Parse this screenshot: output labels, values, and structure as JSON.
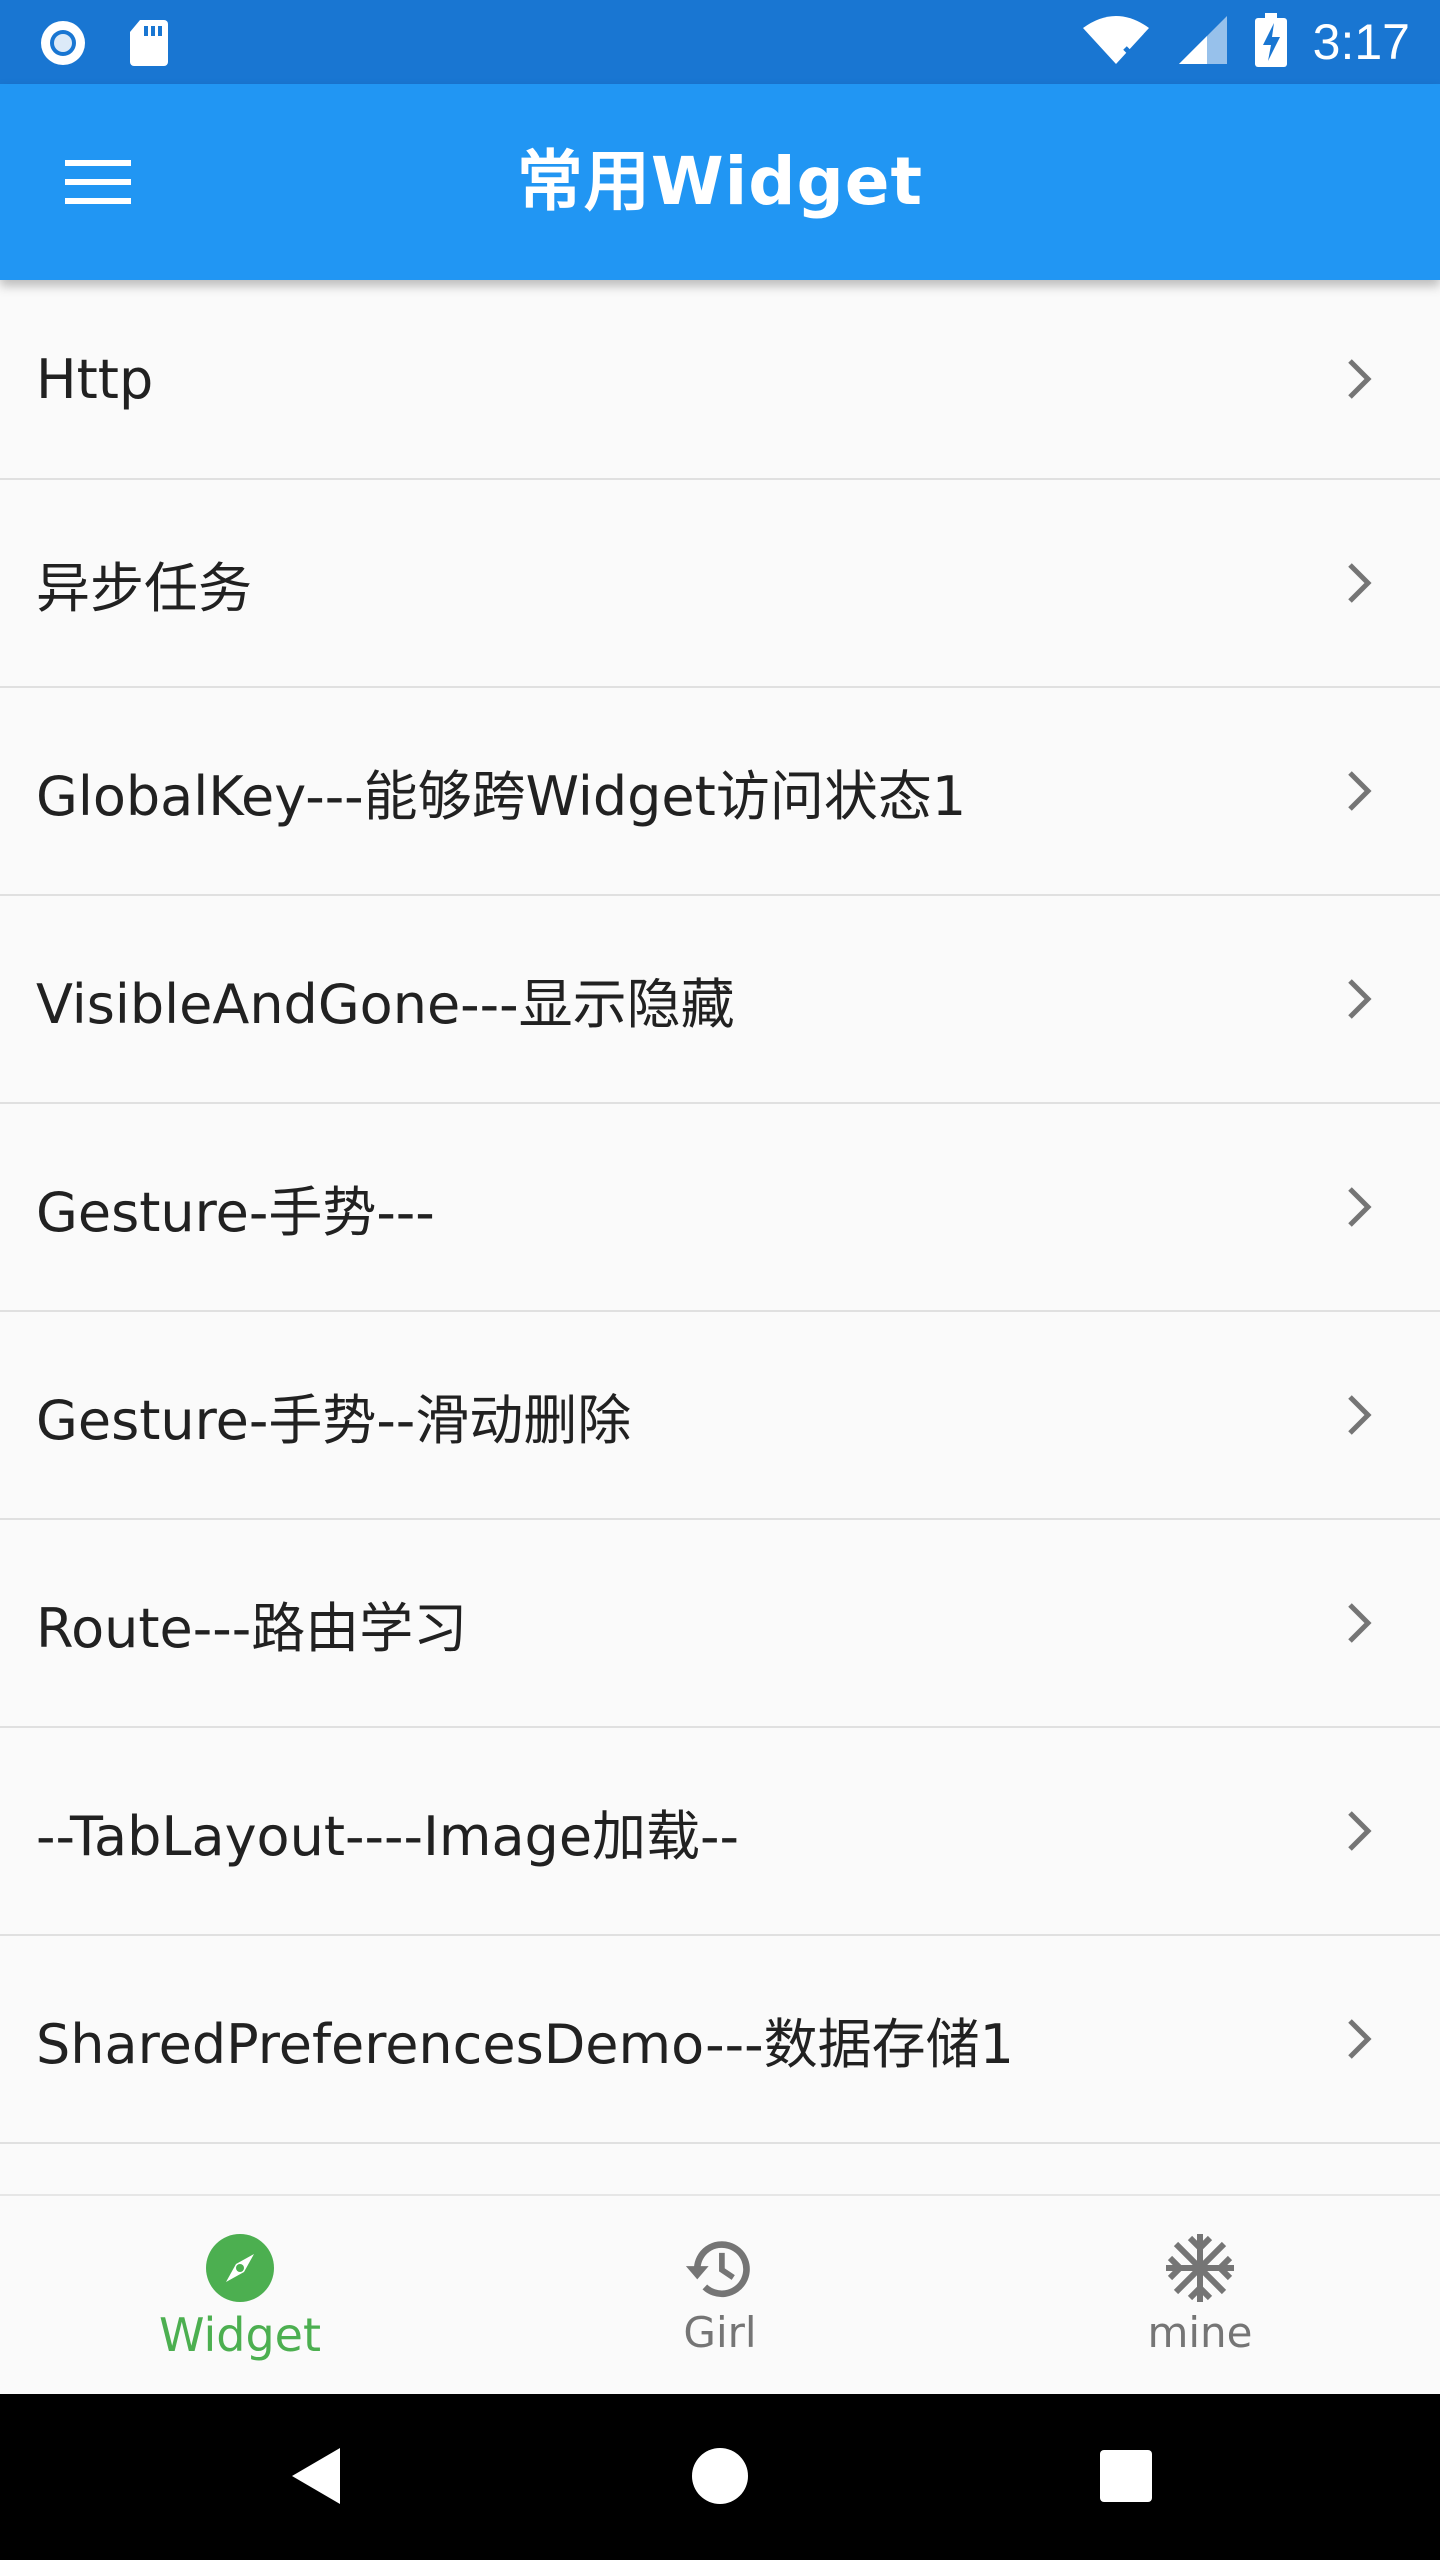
{
  "status_bar": {
    "time": "3:17",
    "icons": [
      "record-icon",
      "sd-card-icon",
      "wifi-icon",
      "signal-icon",
      "battery-charging-icon"
    ]
  },
  "app_bar": {
    "title": "常用Widget",
    "menu_icon": "menu-icon"
  },
  "list": {
    "items": [
      {
        "label": "Http"
      },
      {
        "label": "异步任务"
      },
      {
        "label": "GlobalKey---能够跨Widget访问状态1"
      },
      {
        "label": "VisibleAndGone---显示隐藏"
      },
      {
        "label": "Gesture-手势---"
      },
      {
        "label": "Gesture-手势--滑动删除"
      },
      {
        "label": "Route---路由学习"
      },
      {
        "label": "--TabLayout----Image加载--"
      },
      {
        "label": "SharedPreferencesDemo---数据存储1"
      }
    ],
    "chevron_icon": "chevron-right-icon"
  },
  "bottom_nav": {
    "items": [
      {
        "label": "Widget",
        "icon": "compass-icon",
        "active": true
      },
      {
        "label": "Girl",
        "icon": "history-icon",
        "active": false
      },
      {
        "label": "mine",
        "icon": "snowflake-icon",
        "active": false
      }
    ],
    "active_color": "#4caf50",
    "inactive_color": "#757575"
  },
  "system_nav": {
    "buttons": [
      "back-icon",
      "home-icon",
      "recents-icon"
    ]
  },
  "colors": {
    "status_bar": "#1976d2",
    "app_bar": "#2196f3",
    "background": "#fafafa",
    "divider": "#e0e0e0"
  }
}
